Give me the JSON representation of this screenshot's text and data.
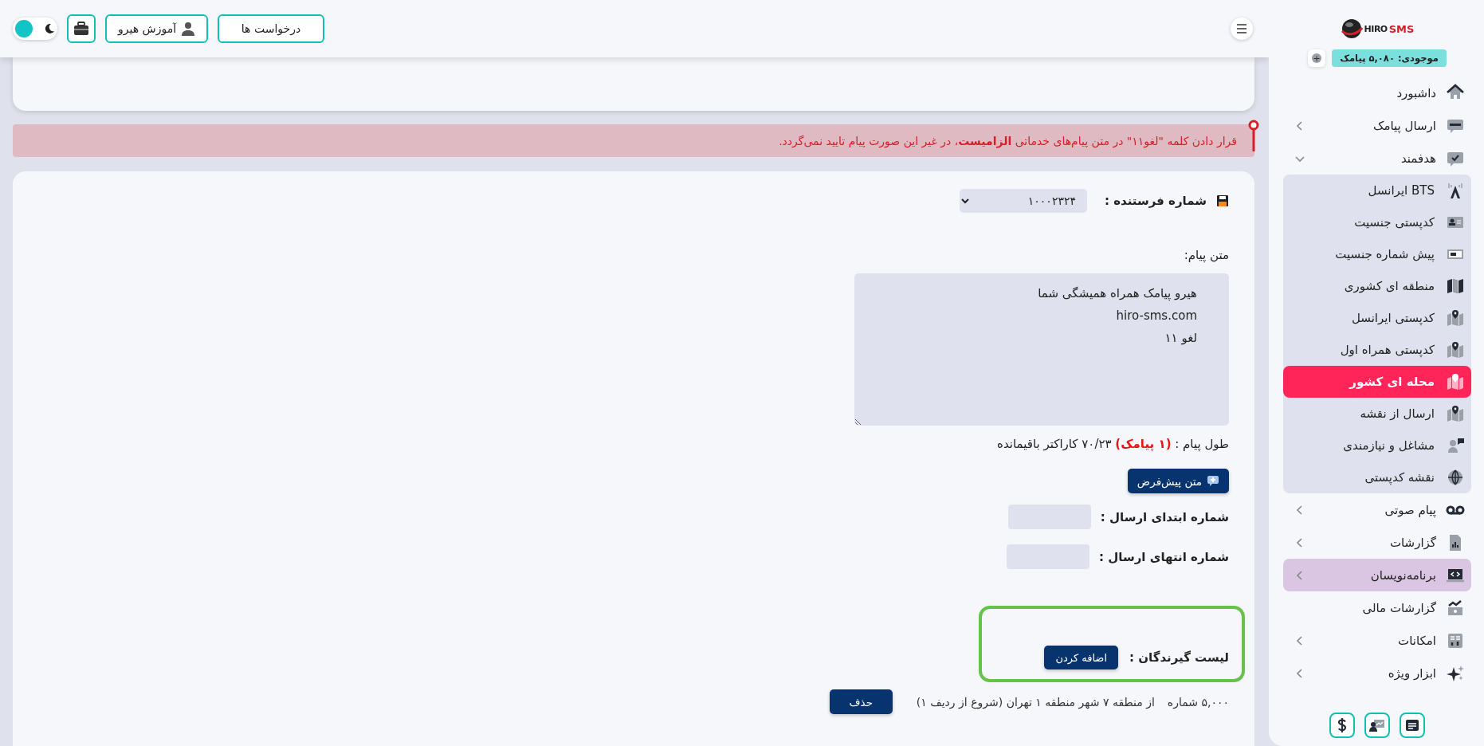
{
  "sidebar": {
    "logo": {
      "text_1": "HIRO",
      "text_2": "SMS"
    },
    "balance": "موجودی: ۵,۰۸۰ پیامک",
    "balance_add": "+",
    "items": [
      {
        "label": "داشبورد",
        "selected": false,
        "hovered": false
      },
      {
        "label": "ارسال پیامک",
        "selected": false,
        "hovered": false,
        "expanded": false
      },
      {
        "label": "هدفمند",
        "selected": false,
        "hovered": false,
        "expanded": true,
        "children": [
          {
            "label": "BTS ایرانسل",
            "selected": false
          },
          {
            "label": "کدپستی جنسیت",
            "selected": false
          },
          {
            "label": "پیش شماره جنسیت",
            "selected": false
          },
          {
            "label": "منطقه ای کشوری",
            "selected": false
          },
          {
            "label": "کدپستی ایرانسل",
            "selected": false
          },
          {
            "label": "کدپستی همراه اول",
            "selected": false
          },
          {
            "label": "محله ای کشور",
            "selected": true
          },
          {
            "label": "ارسال از نقشه",
            "selected": false
          },
          {
            "label": "مشاغل و نیازمندی",
            "selected": false
          },
          {
            "label": "نقشه کدپستی",
            "selected": false
          }
        ]
      },
      {
        "label": "پیام صوتی",
        "selected": false,
        "hovered": false,
        "expanded": false
      },
      {
        "label": "گزارشات",
        "selected": false,
        "hovered": false,
        "expanded": false
      },
      {
        "label": "برنامه‌نویسان",
        "selected": false,
        "hovered": true,
        "expanded": false
      },
      {
        "label": "گزارشات مالی",
        "selected": false,
        "hovered": false
      },
      {
        "label": "امکانات",
        "selected": false,
        "hovered": false,
        "expanded": false
      },
      {
        "label": "ابزار ویژه",
        "selected": false,
        "hovered": false,
        "expanded": false
      }
    ]
  },
  "header": {
    "requests_button": "درخواست ها",
    "tutorial_button": "آموزش هیرو",
    "theme_toggle": {
      "on": false
    }
  },
  "alert": "قرار دادن کلمه \"لغو۱۱\" در متن پیام‌های خدماتی **الزامیست**، در غیر این صورت پیام تایید نمی‌گردد.",
  "form": {
    "sender_label": "شماره فرستنده :",
    "sender_value": "۱۰۰۰۲۳۲۴",
    "message_label": "متن پیام:",
    "message_value": "هیرو پیامک همراه همیشگی شما\nhiro-sms.com\nلغو ۱۱",
    "length_text": "طول پیام : **(۱ پیامک)** ۷۰/۲۳ کاراکتر باقیمانده",
    "default_text_button": "متن پیش‌فرض",
    "start_label": "شماره ابتدای ارسال :",
    "end_label": "شماره انتهای ارسال :",
    "recipients_label": "لیست گیرندگان :",
    "add_button": "اضافه کردن",
    "recipients": [
      {
        "count": "۵,۰۰۰ شماره",
        "description": "از منطقه ۷ شهر منطقه ۱ تهران (شروع از ردیف ۱)",
        "delete_button": "حذف"
      }
    ]
  }
}
